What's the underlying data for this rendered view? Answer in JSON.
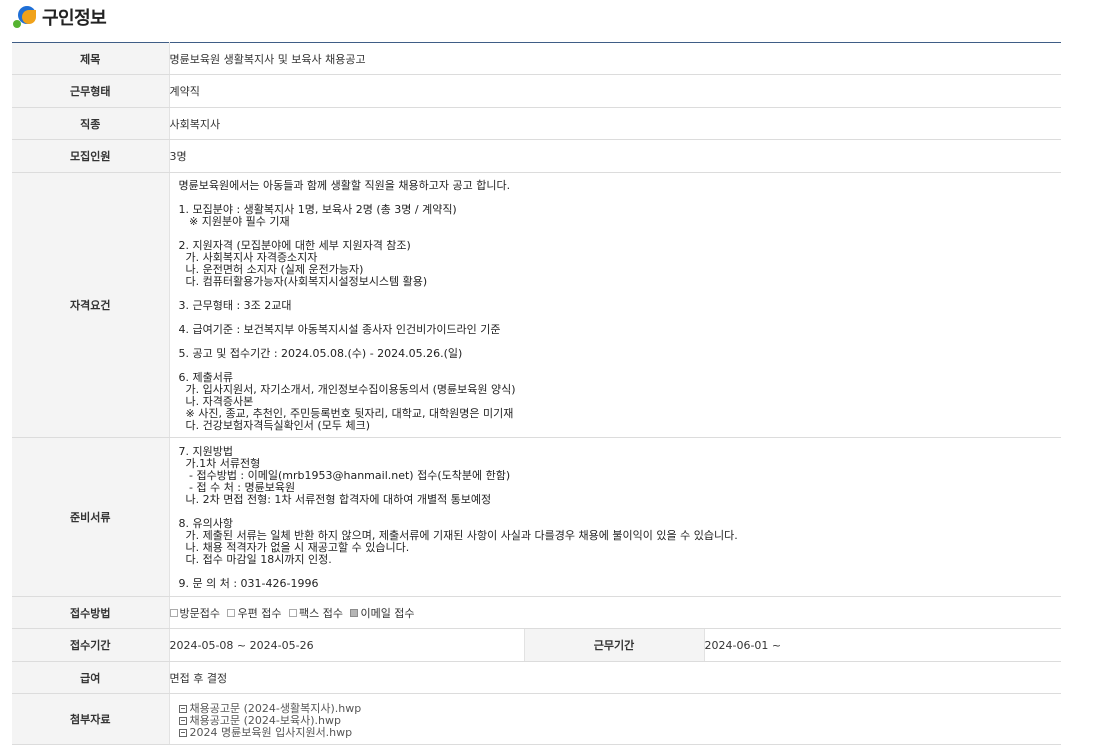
{
  "page": {
    "title": "구인정보"
  },
  "rows": {
    "subject": {
      "label": "제목",
      "value": "명륜보육원 생활복지사 및 보육사 채용공고"
    },
    "employment_type": {
      "label": "근무형태",
      "value": "계약직"
    },
    "job_type": {
      "label": "직종",
      "value": "사회복지사"
    },
    "headcount": {
      "label": "모집인원",
      "value": "3명"
    },
    "qualifications": {
      "label": "자격요건",
      "value": "명륜보육원에서는 아동들과 함께 생활할 직원을 채용하고자 공고 합니다.\n\n1. 모집분야 : 생활복지사 1명, 보육사 2명 (총 3명 / 계약직)\n   ※ 지원분야 필수 기재\n\n2. 지원자격 (모집분야에 대한 세부 지원자격 참조)\n  가. 사회복지사 자격증소지자\n  나. 운전면허 소지자 (실제 운전가능자)\n  다. 컴퓨터활용가능자(사회복지시설정보시스템 활용)\n\n3. 근무형태 : 3조 2교대\n\n4. 급여기준 : 보건복지부 아동복지시설 종사자 인건비가이드라인 기준\n\n5. 공고 및 접수기간 : 2024.05.08.(수) - 2024.05.26.(일)\n\n6. 제출서류\n  가. 입사지원서, 자기소개서, 개인정보수집이용동의서 (명륜보육원 양식)\n  나. 자격증사본\n  ※ 사진, 종교, 추천인, 주민등록번호 뒷자리, 대학교, 대학원명은 미기재\n  다. 건강보험자격득실확인서 (모두 체크)"
    },
    "documents": {
      "label": "준비서류",
      "value": "7. 지원방법\n  가.1차 서류전형\n   - 접수방법 : 이메일(mrb1953@hanmail.net) 접수(도착분에 한함)\n   - 접 수 처 : 명륜보육원\n  나. 2차 면접 전형: 1차 서류전형 합격자에 대하여 개별적 통보예정\n\n8. 유의사항\n  가. 제출된 서류는 일체 반환 하지 않으며, 제출서류에 기재된 사항이 사실과 다를경우 채용에 불이익이 있을 수 있습니다.\n  나. 채용 적격자가 없을 시 재공고할 수 있습니다.\n  다. 접수 마감일 18시까지 인정.\n\n9. 문 의 처 : 031-426-1996"
    },
    "apply_method": {
      "label": "접수방법",
      "options": [
        {
          "label": "방문접수",
          "checked": false
        },
        {
          "label": "우편 접수",
          "checked": false
        },
        {
          "label": "팩스 접수",
          "checked": false
        },
        {
          "label": "이메일 접수",
          "checked": true
        }
      ]
    },
    "period": {
      "label": "접수기간",
      "value": "2024-05-08 ~ 2024-05-26",
      "work_label": "근무기간",
      "work_value": "2024-06-01 ~"
    },
    "salary": {
      "label": "급여",
      "value": "면접 후 결정"
    },
    "attachments": {
      "label": "첨부자료",
      "files": [
        {
          "name": "채용공고문 (2024-생활복지사).hwp"
        },
        {
          "name": "채용공고문 (2024-보육사).hwp"
        },
        {
          "name": "2024 명륜보육원 입사지원서.hwp"
        }
      ]
    }
  }
}
